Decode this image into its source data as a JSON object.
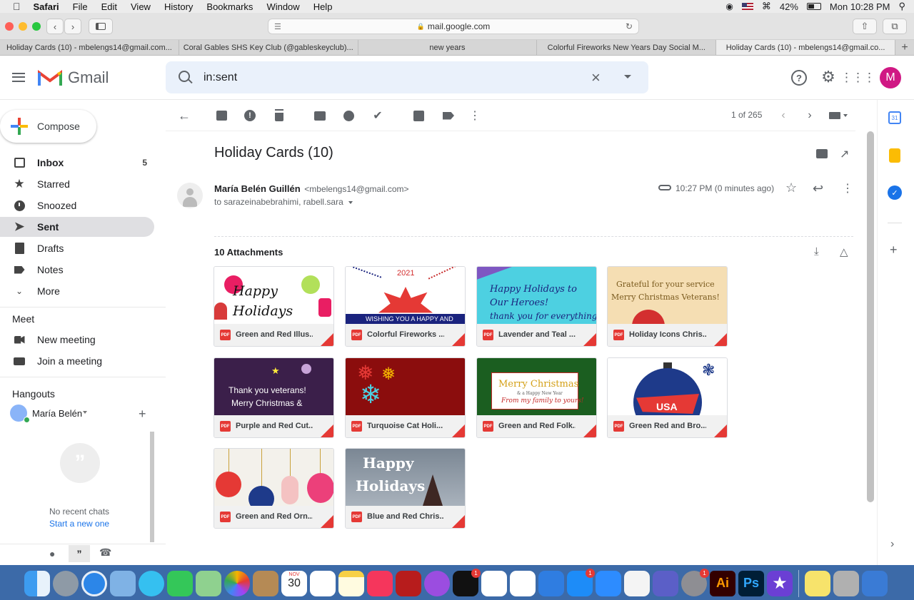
{
  "menubar": {
    "app": "Safari",
    "items": [
      "File",
      "Edit",
      "View",
      "History",
      "Bookmarks",
      "Window",
      "Help"
    ],
    "battery": "42%",
    "clock": "Mon 10:28 PM"
  },
  "browser": {
    "url": "mail.google.com",
    "tabs": [
      "Holiday Cards (10) - mbelengs14@gmail.com...",
      "Coral Gables SHS Key Club (@gableskeyclub)...",
      "new years",
      "Colorful Fireworks New Years Day Social M...",
      "Holiday Cards (10) - mbelengs14@gmail.co..."
    ],
    "active_tab": 4
  },
  "gmail": {
    "logo": "Gmail",
    "search_query": "in:sent",
    "avatar_letter": "M"
  },
  "sidebar": {
    "compose": "Compose",
    "items": [
      {
        "label": "Inbox",
        "count": "5"
      },
      {
        "label": "Starred",
        "count": ""
      },
      {
        "label": "Snoozed",
        "count": ""
      },
      {
        "label": "Sent",
        "count": ""
      },
      {
        "label": "Drafts",
        "count": ""
      },
      {
        "label": "Notes",
        "count": ""
      },
      {
        "label": "More",
        "count": ""
      }
    ],
    "selected": "Sent",
    "meet_title": "Meet",
    "meet_items": [
      "New meeting",
      "Join a meeting"
    ],
    "hangouts_title": "Hangouts",
    "hangouts_user": "María Belén",
    "no_chats": "No recent chats",
    "start_chat": "Start a new one"
  },
  "toolbar": {
    "pagination": "1 of 265"
  },
  "message": {
    "subject": "Holiday Cards (10)",
    "sender_name": "María Belén Guillén",
    "sender_email": "<mbelengs14@gmail.com>",
    "recipients": "to sarazeinabebrahimi, rabell.sara",
    "time": "10:27 PM (0 minutes ago)"
  },
  "attachments": {
    "title": "10 Attachments",
    "pdf_label": "PDF",
    "items": [
      {
        "name": "Green and Red Illus...",
        "thumb": "Happy Holidays"
      },
      {
        "name": "Colorful Fireworks ...",
        "thumb": "2021",
        "thumb2": "WISHING YOU A HAPPY AND"
      },
      {
        "name": "Lavender and Teal ...",
        "thumb": "Happy Holidays to Our Heroes!",
        "thumb2": "thank you for everything"
      },
      {
        "name": "Holiday Icons Chris...",
        "thumb": "Grateful for your service",
        "thumb2": "Merry Christmas Veterans!"
      },
      {
        "name": "Purple and Red Cut...",
        "thumb": "Thank you veterans!",
        "thumb2": "Merry Christmas &"
      },
      {
        "name": "Turquoise Cat Holi...",
        "thumb": ""
      },
      {
        "name": "Green and Red Folk...",
        "thumb": "Merry Christmas",
        "thumb2": "& a Happy New Year",
        "thumb3": "From my family to yours!"
      },
      {
        "name": "Green Red and Bro...",
        "thumb": "USA"
      },
      {
        "name": "Green and Red Orn...",
        "thumb": ""
      },
      {
        "name": "Blue and Red Chris...",
        "thumb": "Happy",
        "thumb2": "Holidays"
      }
    ]
  },
  "dock": {
    "calendar_month": "NOV",
    "calendar_day": "30",
    "badges": [
      "1",
      "1",
      "1",
      "1"
    ]
  },
  "colors": {
    "accent_red": "#e53935",
    "selected_nav": "#dfdfe2",
    "search_bg": "#eaf1fb",
    "link_blue": "#1a73e8",
    "avatar": "#d01884"
  }
}
